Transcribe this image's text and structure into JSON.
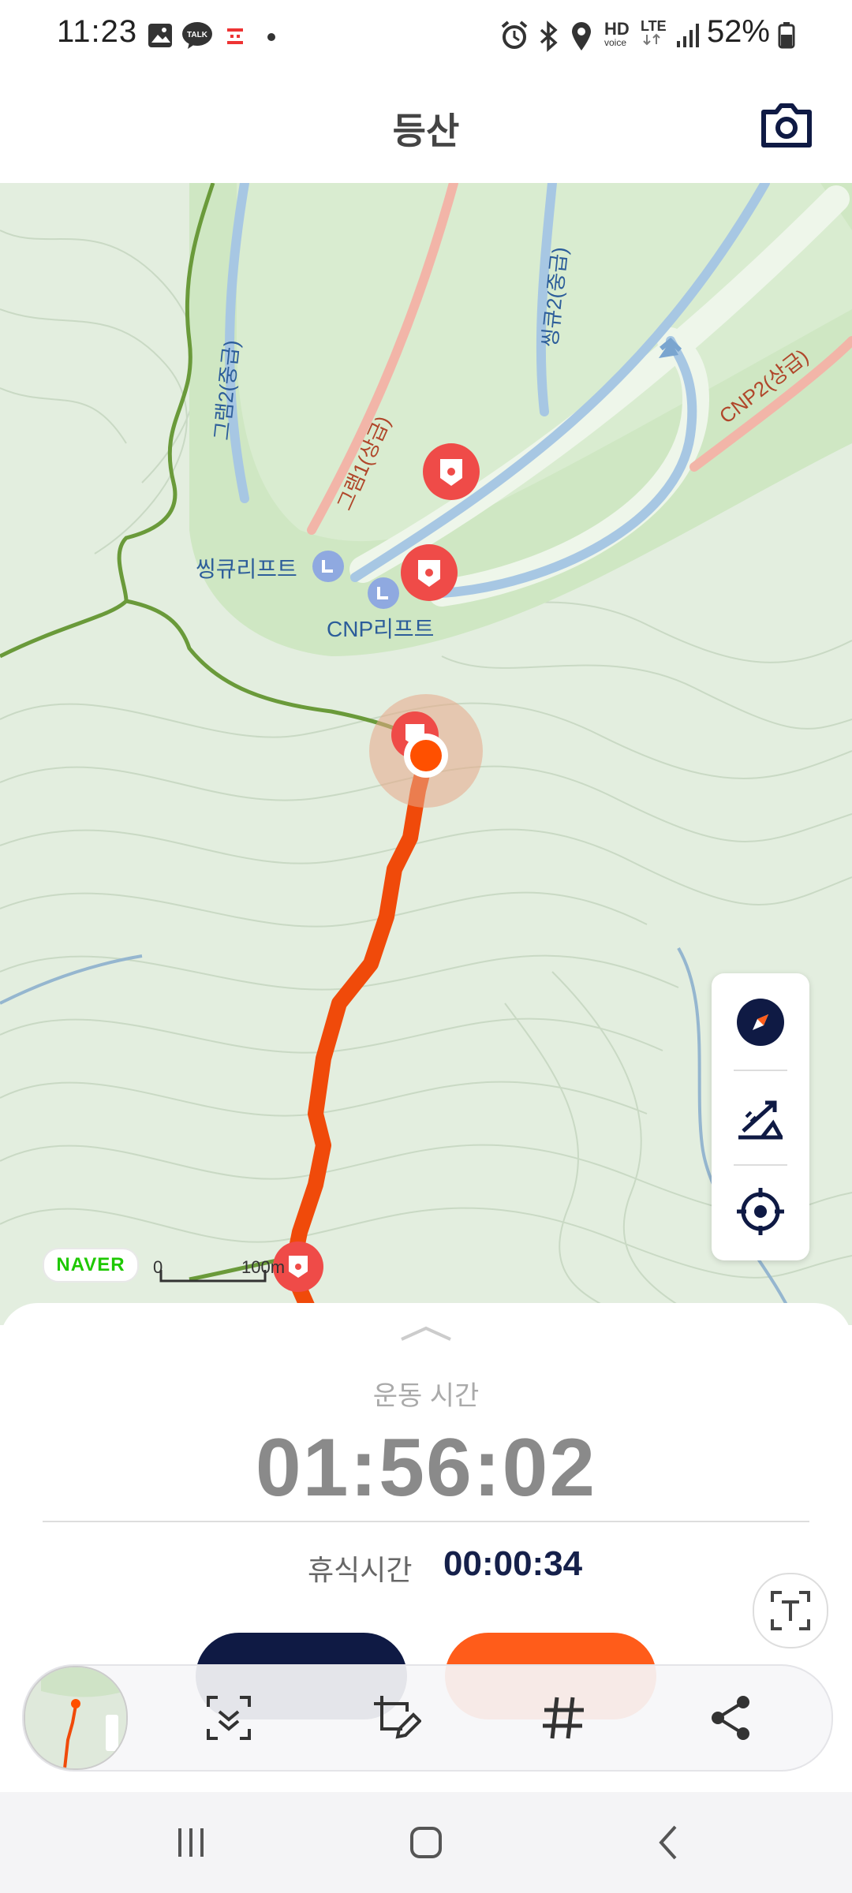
{
  "status_bar": {
    "time": "11:23",
    "battery": "52%",
    "icons": [
      "gallery-icon",
      "talk-icon",
      "calendar-icon",
      "dot-icon",
      "alarm-icon",
      "bluetooth-icon",
      "location-icon",
      "hd-voice-icon",
      "lte-icon",
      "signal-icon",
      "battery-icon"
    ],
    "talk_badge": "TALK",
    "hd_label": "HD",
    "voice_label": "voice",
    "lte_label": "LTE"
  },
  "header": {
    "title": "등산",
    "camera_icon": "camera-icon"
  },
  "map": {
    "labels": {
      "lift_1": "씽큐리프트",
      "lift_2": "CNP리프트",
      "piste_1": "그램2(중급)",
      "piste_2": "그램1(상급)",
      "piste_3": "씽큐2(중급)",
      "piste_4": "CNP2(상급)"
    },
    "controls": [
      "compass-icon",
      "elevation-icon",
      "locate-icon"
    ],
    "brand": "NAVER",
    "scale_start": "0",
    "scale_end": "100m",
    "colors": {
      "route": "#f04a0a",
      "trail": "#6a9a3a",
      "piste_blue": "#a7c7e3",
      "piste_red": "#f2b5a8",
      "marker": "#ef4b48"
    }
  },
  "workout": {
    "exercise_label": "운동 시간",
    "exercise_time": "01:56:02",
    "rest_label": "휴식시간",
    "rest_time": "00:00:34",
    "pause_color": "#0f1a44",
    "stop_color": "#ff5c1a"
  },
  "screenshot_toolbar": {
    "tools": [
      "scroll-capture-icon",
      "edit-crop-icon",
      "hashtag-icon",
      "share-icon"
    ]
  },
  "nav_bar": {
    "buttons": [
      "recents-icon",
      "home-icon",
      "back-icon"
    ]
  }
}
